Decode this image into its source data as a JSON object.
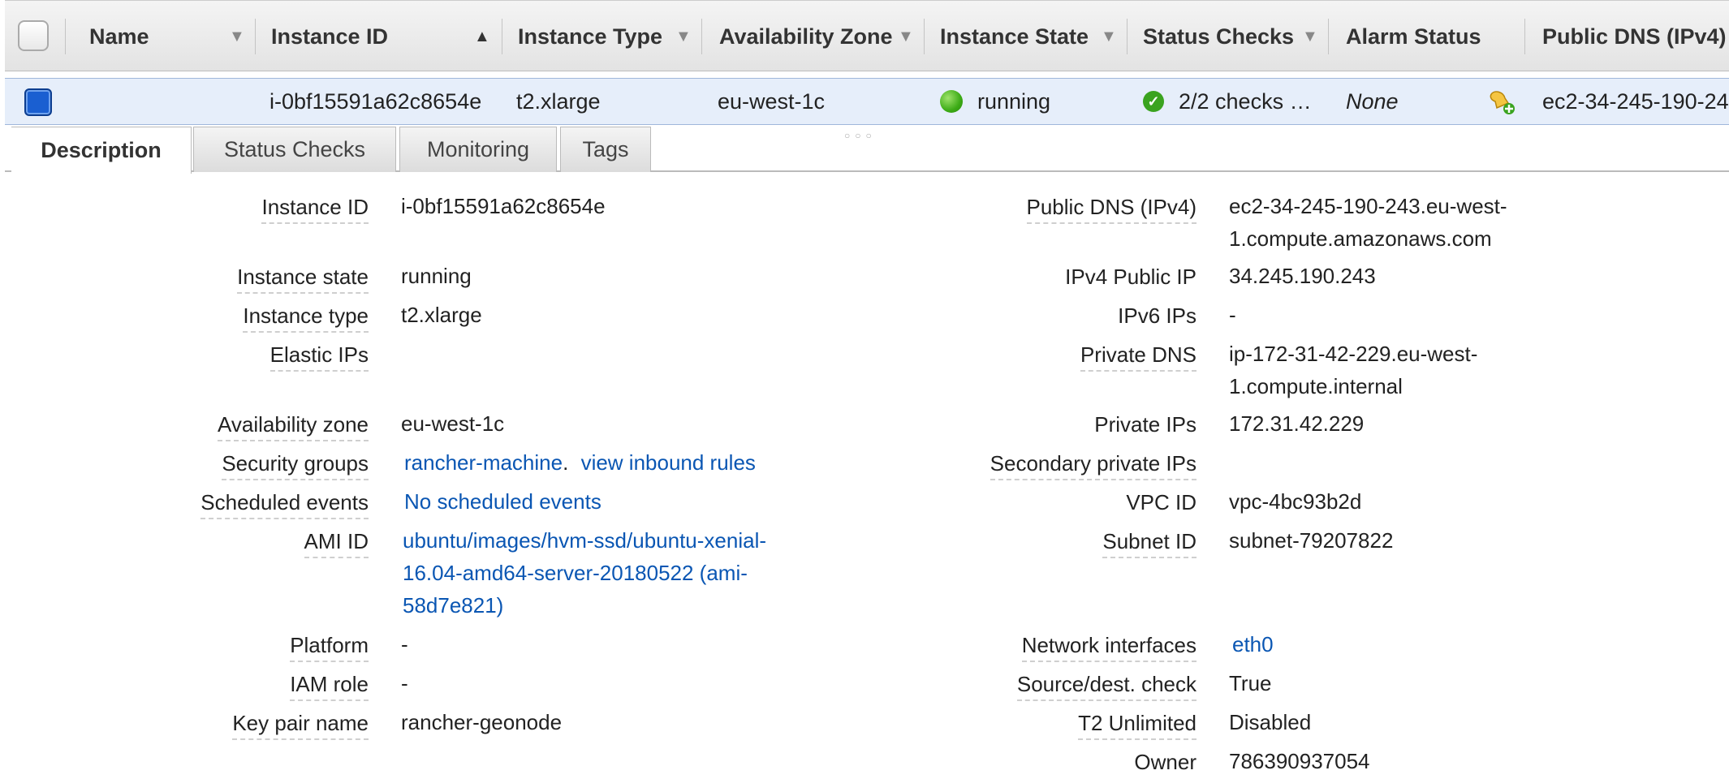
{
  "header": {
    "name": "Name",
    "instance_id": "Instance ID",
    "instance_type": "Instance Type",
    "availability_zone": "Availability Zone",
    "instance_state": "Instance State",
    "status_checks": "Status Checks",
    "alarm_status": "Alarm Status",
    "public_dns": "Public DNS (IPv4)"
  },
  "row": {
    "instance_id": "i-0bf15591a62c8654e",
    "instance_type": "t2.xlarge",
    "availability_zone": "eu-west-1c",
    "instance_state": "running",
    "status_checks": "2/2 checks …",
    "alarm_status": "None",
    "public_dns": "ec2-34-245-190-24"
  },
  "tabs": [
    "Description",
    "Status Checks",
    "Monitoring",
    "Tags"
  ],
  "details_left": {
    "instance_id_label": "Instance ID",
    "instance_id": "i-0bf15591a62c8654e",
    "instance_state_label": "Instance state",
    "instance_state": "running",
    "instance_type_label": "Instance type",
    "instance_type": "t2.xlarge",
    "elastic_ips_label": "Elastic IPs",
    "availability_zone_label": "Availability zone",
    "availability_zone": "eu-west-1c",
    "security_groups_label": "Security groups",
    "security_group": "rancher-machine",
    "security_group_sep": ".",
    "view_inbound_rules": "view inbound rules",
    "scheduled_events_label": "Scheduled events",
    "scheduled_events": "No scheduled events",
    "ami_id_label": "AMI ID",
    "ami_id_line1": "ubuntu/images/hvm-ssd/ubuntu-xenial-",
    "ami_id_line2": "16.04-amd64-server-20180522 (ami-",
    "ami_id_line3": "58d7e821)",
    "platform_label": "Platform",
    "platform": "-",
    "iam_role_label": "IAM role",
    "iam_role": "-",
    "key_pair_label": "Key pair name",
    "key_pair": "rancher-geonode"
  },
  "details_right": {
    "public_dns_label": "Public DNS (IPv4)",
    "public_dns_line1": "ec2-34-245-190-243.eu-west-",
    "public_dns_line2": "1.compute.amazonaws.com",
    "ipv4_public_ip_label": "IPv4 Public IP",
    "ipv4_public_ip": "34.245.190.243",
    "ipv6_ips_label": "IPv6 IPs",
    "ipv6_ips": "-",
    "private_dns_label": "Private DNS",
    "private_dns_line1": "ip-172-31-42-229.eu-west-",
    "private_dns_line2": "1.compute.internal",
    "private_ips_label": "Private IPs",
    "private_ips": "172.31.42.229",
    "secondary_private_ips_label": "Secondary private IPs",
    "vpc_id_label": "VPC ID",
    "vpc_id": "vpc-4bc93b2d",
    "subnet_id_label": "Subnet ID",
    "subnet_id": "subnet-79207822",
    "network_interfaces_label": "Network interfaces",
    "network_interfaces": "eth0",
    "source_dest_check_label": "Source/dest. check",
    "source_dest_check": "True",
    "t2_unlimited_label": "T2 Unlimited",
    "t2_unlimited": "Disabled",
    "owner_label": "Owner",
    "owner": "786390937054"
  },
  "colors": {
    "link": "#0a56b3",
    "selected_row": "#e6eefa",
    "running": "#3cab16",
    "checkbox_checked": "#1a5fd1"
  },
  "icons": {
    "state": "green-dot-icon",
    "status": "check-circle-icon",
    "alarm": "add-alarm-icon"
  }
}
